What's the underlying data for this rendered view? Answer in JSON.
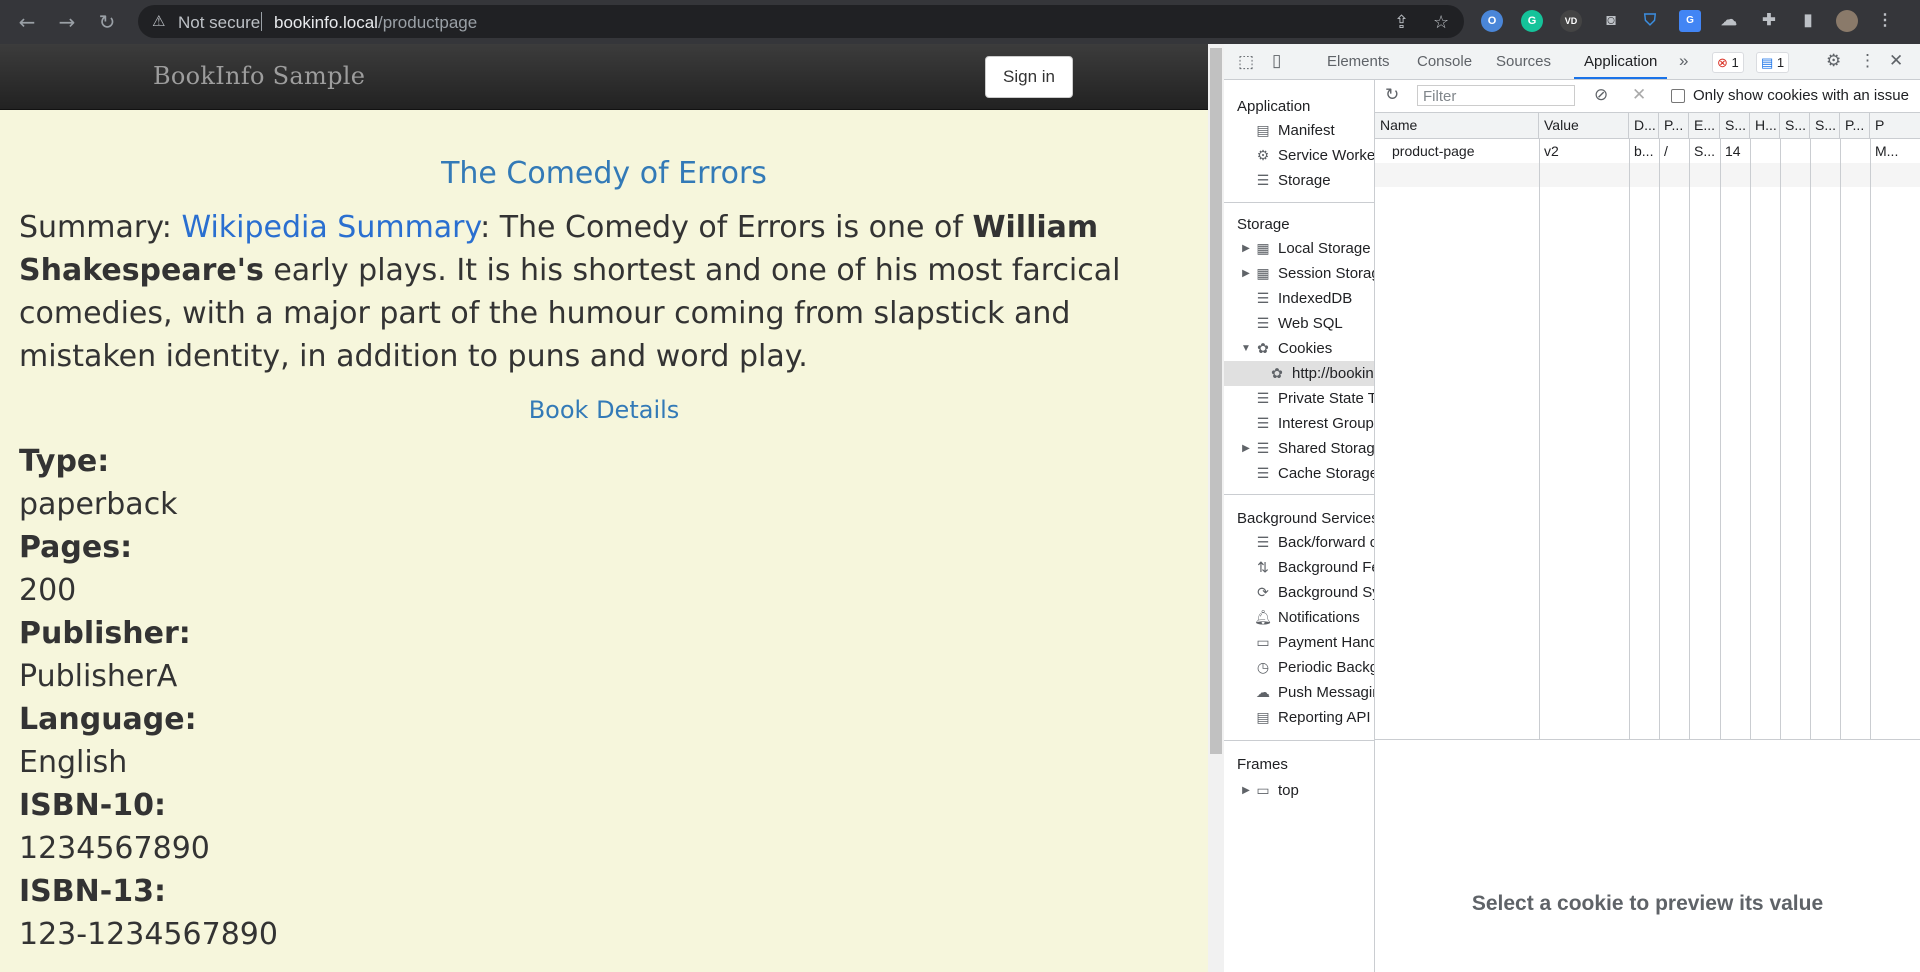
{
  "browser": {
    "security_label": "Not secure",
    "url_host": "bookinfo.local",
    "url_path": "/productpage"
  },
  "page": {
    "brand": "BookInfo Sample",
    "signin_label": "Sign in",
    "book_title": "The Comedy of Errors",
    "summary": {
      "prefix": "Summary: ",
      "link_text": "Wikipedia Summary",
      "text_before_bold": ": The Comedy of Errors is one of ",
      "bold_text": "William Shakespeare's",
      "text_after_bold": " early plays. It is his shortest and one of his most farcical comedies, with a major part of the humour coming from slapstick and mistaken identity, in addition to puns and word play."
    },
    "details_heading": "Book Details",
    "details": [
      {
        "label": "Type:",
        "value": "paperback"
      },
      {
        "label": "Pages:",
        "value": "200"
      },
      {
        "label": "Publisher:",
        "value": "PublisherA"
      },
      {
        "label": "Language:",
        "value": "English"
      },
      {
        "label": "ISBN-10:",
        "value": "1234567890"
      },
      {
        "label": "ISBN-13:",
        "value": "123-1234567890"
      }
    ]
  },
  "devtools": {
    "tabs": [
      "Elements",
      "Console",
      "Sources",
      "Application"
    ],
    "active_tab": "Application",
    "more_tabs": "»",
    "error_count": "1",
    "message_count": "1",
    "sidebar": {
      "application_section": "Application",
      "application_items": [
        "Manifest",
        "Service Workers",
        "Storage"
      ],
      "storage_section": "Storage",
      "storage_items": [
        "Local Storage",
        "Session Storage",
        "IndexedDB",
        "Web SQL",
        "Cookies",
        "http://bookinfo.local",
        "Private State Tokens",
        "Interest Groups",
        "Shared Storage",
        "Cache Storage"
      ],
      "background_section": "Background Services",
      "background_items": [
        "Back/forward cache",
        "Background Fetch",
        "Background Sync",
        "Notifications",
        "Payment Handler",
        "Periodic Background Sync",
        "Push Messaging",
        "Reporting API"
      ],
      "frames_section": "Frames",
      "frames_items": [
        "top"
      ]
    },
    "filter_placeholder": "Filter",
    "only_issues_label": "Only show cookies with an issue",
    "columns": [
      "Name",
      "Value",
      "D...",
      "P...",
      "E...",
      "S...",
      "H...",
      "S...",
      "S...",
      "P...",
      "P"
    ],
    "cookies": [
      {
        "name": "product-page",
        "value": "v2",
        "domain": "b...",
        "path": "/",
        "expires": "S...",
        "size": "14",
        "httponly": "",
        "secure": "",
        "samesite": "",
        "partition": "",
        "priority": "M..."
      }
    ],
    "preview_message": "Select a cookie to preview its value"
  }
}
